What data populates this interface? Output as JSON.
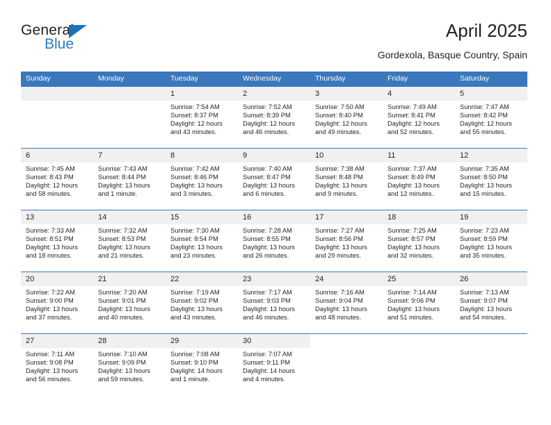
{
  "brand": {
    "name_part1": "General",
    "name_part2": "Blue",
    "triangle_color": "#1c72b8",
    "blue_text_color": "#2b7cc4"
  },
  "header": {
    "title": "April 2025",
    "subtitle": "Gordexola, Basque Country, Spain"
  },
  "theme": {
    "header_bg": "#3b77bc",
    "daynum_bg": "#f0f0f0",
    "row_border": "#3b77bc",
    "text": "#231f20"
  },
  "labels": {
    "sunrise_prefix": "Sunrise: ",
    "sunset_prefix": "Sunset: ",
    "daylight_prefix": "Daylight: "
  },
  "weekday_headers": [
    "Sunday",
    "Monday",
    "Tuesday",
    "Wednesday",
    "Thursday",
    "Friday",
    "Saturday"
  ],
  "weeks": [
    [
      {
        "empty": true
      },
      {
        "empty": true
      },
      {
        "day": "1",
        "sunrise": "Sunrise: 7:54 AM",
        "sunset": "Sunset: 8:37 PM",
        "daylight": "Daylight: 12 hours and 43 minutes."
      },
      {
        "day": "2",
        "sunrise": "Sunrise: 7:52 AM",
        "sunset": "Sunset: 8:39 PM",
        "daylight": "Daylight: 12 hours and 46 minutes."
      },
      {
        "day": "3",
        "sunrise": "Sunrise: 7:50 AM",
        "sunset": "Sunset: 8:40 PM",
        "daylight": "Daylight: 12 hours and 49 minutes."
      },
      {
        "day": "4",
        "sunrise": "Sunrise: 7:49 AM",
        "sunset": "Sunset: 8:41 PM",
        "daylight": "Daylight: 12 hours and 52 minutes."
      },
      {
        "day": "5",
        "sunrise": "Sunrise: 7:47 AM",
        "sunset": "Sunset: 8:42 PM",
        "daylight": "Daylight: 12 hours and 55 minutes."
      }
    ],
    [
      {
        "day": "6",
        "sunrise": "Sunrise: 7:45 AM",
        "sunset": "Sunset: 8:43 PM",
        "daylight": "Daylight: 12 hours and 58 minutes."
      },
      {
        "day": "7",
        "sunrise": "Sunrise: 7:43 AM",
        "sunset": "Sunset: 8:44 PM",
        "daylight": "Daylight: 13 hours and 1 minute."
      },
      {
        "day": "8",
        "sunrise": "Sunrise: 7:42 AM",
        "sunset": "Sunset: 8:46 PM",
        "daylight": "Daylight: 13 hours and 3 minutes."
      },
      {
        "day": "9",
        "sunrise": "Sunrise: 7:40 AM",
        "sunset": "Sunset: 8:47 PM",
        "daylight": "Daylight: 13 hours and 6 minutes."
      },
      {
        "day": "10",
        "sunrise": "Sunrise: 7:38 AM",
        "sunset": "Sunset: 8:48 PM",
        "daylight": "Daylight: 13 hours and 9 minutes."
      },
      {
        "day": "11",
        "sunrise": "Sunrise: 7:37 AM",
        "sunset": "Sunset: 8:49 PM",
        "daylight": "Daylight: 13 hours and 12 minutes."
      },
      {
        "day": "12",
        "sunrise": "Sunrise: 7:35 AM",
        "sunset": "Sunset: 8:50 PM",
        "daylight": "Daylight: 13 hours and 15 minutes."
      }
    ],
    [
      {
        "day": "13",
        "sunrise": "Sunrise: 7:33 AM",
        "sunset": "Sunset: 8:51 PM",
        "daylight": "Daylight: 13 hours and 18 minutes."
      },
      {
        "day": "14",
        "sunrise": "Sunrise: 7:32 AM",
        "sunset": "Sunset: 8:53 PM",
        "daylight": "Daylight: 13 hours and 21 minutes."
      },
      {
        "day": "15",
        "sunrise": "Sunrise: 7:30 AM",
        "sunset": "Sunset: 8:54 PM",
        "daylight": "Daylight: 13 hours and 23 minutes."
      },
      {
        "day": "16",
        "sunrise": "Sunrise: 7:28 AM",
        "sunset": "Sunset: 8:55 PM",
        "daylight": "Daylight: 13 hours and 26 minutes."
      },
      {
        "day": "17",
        "sunrise": "Sunrise: 7:27 AM",
        "sunset": "Sunset: 8:56 PM",
        "daylight": "Daylight: 13 hours and 29 minutes."
      },
      {
        "day": "18",
        "sunrise": "Sunrise: 7:25 AM",
        "sunset": "Sunset: 8:57 PM",
        "daylight": "Daylight: 13 hours and 32 minutes."
      },
      {
        "day": "19",
        "sunrise": "Sunrise: 7:23 AM",
        "sunset": "Sunset: 8:59 PM",
        "daylight": "Daylight: 13 hours and 35 minutes."
      }
    ],
    [
      {
        "day": "20",
        "sunrise": "Sunrise: 7:22 AM",
        "sunset": "Sunset: 9:00 PM",
        "daylight": "Daylight: 13 hours and 37 minutes."
      },
      {
        "day": "21",
        "sunrise": "Sunrise: 7:20 AM",
        "sunset": "Sunset: 9:01 PM",
        "daylight": "Daylight: 13 hours and 40 minutes."
      },
      {
        "day": "22",
        "sunrise": "Sunrise: 7:19 AM",
        "sunset": "Sunset: 9:02 PM",
        "daylight": "Daylight: 13 hours and 43 minutes."
      },
      {
        "day": "23",
        "sunrise": "Sunrise: 7:17 AM",
        "sunset": "Sunset: 9:03 PM",
        "daylight": "Daylight: 13 hours and 46 minutes."
      },
      {
        "day": "24",
        "sunrise": "Sunrise: 7:16 AM",
        "sunset": "Sunset: 9:04 PM",
        "daylight": "Daylight: 13 hours and 48 minutes."
      },
      {
        "day": "25",
        "sunrise": "Sunrise: 7:14 AM",
        "sunset": "Sunset: 9:06 PM",
        "daylight": "Daylight: 13 hours and 51 minutes."
      },
      {
        "day": "26",
        "sunrise": "Sunrise: 7:13 AM",
        "sunset": "Sunset: 9:07 PM",
        "daylight": "Daylight: 13 hours and 54 minutes."
      }
    ],
    [
      {
        "day": "27",
        "sunrise": "Sunrise: 7:11 AM",
        "sunset": "Sunset: 9:08 PM",
        "daylight": "Daylight: 13 hours and 56 minutes."
      },
      {
        "day": "28",
        "sunrise": "Sunrise: 7:10 AM",
        "sunset": "Sunset: 9:09 PM",
        "daylight": "Daylight: 13 hours and 59 minutes."
      },
      {
        "day": "29",
        "sunrise": "Sunrise: 7:08 AM",
        "sunset": "Sunset: 9:10 PM",
        "daylight": "Daylight: 14 hours and 1 minute."
      },
      {
        "day": "30",
        "sunrise": "Sunrise: 7:07 AM",
        "sunset": "Sunset: 9:11 PM",
        "daylight": "Daylight: 14 hours and 4 minutes."
      },
      {
        "blank": true
      },
      {
        "blank": true
      },
      {
        "blank": true
      }
    ]
  ]
}
